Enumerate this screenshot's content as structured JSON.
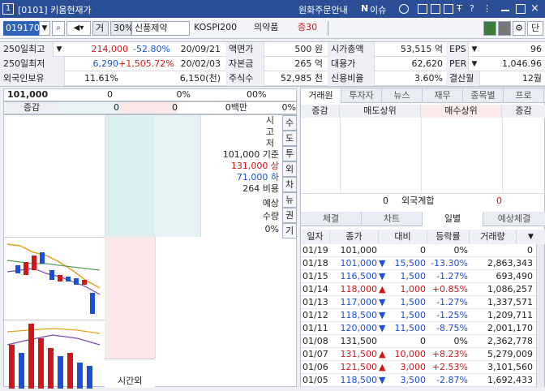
{
  "titlebar": {
    "num": "1",
    "title": "[0101] 키움현재가",
    "items": [
      "원화주문안내",
      "N",
      "이슈"
    ]
  },
  "toolbar": {
    "code": "019170",
    "type": "거",
    "ratio": "30%",
    "name": "신풍제약",
    "index": "KOSPI200",
    "sector": "의약품",
    "margin": "증30"
  },
  "info": [
    {
      "l1": "250일최고",
      "v1": "214,000",
      "v1c": "red",
      "p1": "-52.80%",
      "p1c": "blue",
      "d1": "20/09/21",
      "l2": "액면가",
      "v2": "500 원",
      "l3": "시가총액",
      "v3": "53,515 억",
      "l4": "EPS",
      "v4": "96"
    },
    {
      "l1": "250일최저",
      "v1": "6,290",
      "v1c": "blue",
      "p1": "+1,505.72%",
      "p1c": "red",
      "d1": "20/02/03",
      "l2": "자본금",
      "v2": "265 억",
      "l3": "대용가",
      "v3": "62,620",
      "l4": "PER",
      "v4": "1,046.96"
    },
    {
      "l1": "외국인보유",
      "v1": "11.61%",
      "v1c": "",
      "p1": "6,150(천)",
      "p1c": "",
      "d1": "",
      "l2": "주식수",
      "v2": "52,985 천",
      "l3": "신용비율",
      "v3": "3.60%",
      "l4": "결산월",
      "v4": "12월"
    }
  ],
  "orderbook": {
    "price": "101,000",
    "z1": "0",
    "z2": "0%",
    "z3": "0",
    "z4": "0%",
    "sub_label": "증감",
    "sub1": "0",
    "sub2": "0",
    "sub3": "0백만",
    "sub4": "0%",
    "mid_lines": [
      {
        "t": "시",
        "c": ""
      },
      {
        "t": "고",
        "c": ""
      },
      {
        "t": "저",
        "c": ""
      },
      {
        "t": "101,000 기준",
        "c": ""
      },
      {
        "t": "131,000 상",
        "c": "red"
      },
      {
        "t": "71,000 하",
        "c": "blue"
      },
      {
        "t": "264 비용",
        "c": ""
      },
      {
        "t": "예상",
        "c": ""
      },
      {
        "t": "수량",
        "c": ""
      },
      {
        "t": "0%",
        "c": ""
      }
    ],
    "vtabs": [
      "수",
      "도",
      "투",
      "외",
      "차",
      "뉴",
      "권",
      "기"
    ],
    "after_hours": "시간외"
  },
  "right": {
    "top_tabs": [
      "거래원",
      "투자자",
      "뉴스",
      "재무",
      "종목별",
      "프로"
    ],
    "broker_headers": [
      "증감",
      "매도상위",
      "매수상위",
      "증감"
    ],
    "foreign": {
      "left": "0",
      "label": "외국계합",
      "right": "0"
    },
    "bottom_tabs": [
      "체결",
      "차트",
      "일별",
      "예상체결"
    ],
    "daily_headers": [
      "일자",
      "종가",
      "대비",
      "등락률",
      "거래량"
    ],
    "daily": [
      {
        "date": "01/19",
        "close": "101,000",
        "dir": "",
        "chg": "0",
        "rate": "0%",
        "vol": "0",
        "c": ""
      },
      {
        "date": "01/18",
        "close": "101,000",
        "dir": "▼",
        "chg": "15,500",
        "rate": "-13.30%",
        "vol": "2,863,343",
        "c": "blue"
      },
      {
        "date": "01/15",
        "close": "116,500",
        "dir": "▼",
        "chg": "1,500",
        "rate": "-1.27%",
        "vol": "693,490",
        "c": "blue"
      },
      {
        "date": "01/14",
        "close": "118,000",
        "dir": "▲",
        "chg": "1,000",
        "rate": "+0.85%",
        "vol": "1,086,257",
        "c": "red"
      },
      {
        "date": "01/13",
        "close": "117,000",
        "dir": "▼",
        "chg": "1,500",
        "rate": "-1.27%",
        "vol": "1,337,571",
        "c": "blue"
      },
      {
        "date": "01/12",
        "close": "118,500",
        "dir": "▼",
        "chg": "1,500",
        "rate": "-1.25%",
        "vol": "1,209,711",
        "c": "blue"
      },
      {
        "date": "01/11",
        "close": "120,000",
        "dir": "▼",
        "chg": "11,500",
        "rate": "-8.75%",
        "vol": "2,001,170",
        "c": "blue"
      },
      {
        "date": "01/08",
        "close": "131,500",
        "dir": "",
        "chg": "0",
        "rate": "0%",
        "vol": "2,362,778",
        "c": ""
      },
      {
        "date": "01/07",
        "close": "131,500",
        "dir": "▲",
        "chg": "10,000",
        "rate": "+8.23%",
        "vol": "5,279,009",
        "c": "red"
      },
      {
        "date": "01/06",
        "close": "121,500",
        "dir": "▲",
        "chg": "3,000",
        "rate": "+2.53%",
        "vol": "3,101,560",
        "c": "red"
      },
      {
        "date": "01/05",
        "close": "118,500",
        "dir": "▼",
        "chg": "3,500",
        "rate": "-2.87%",
        "vol": "1,692,433",
        "c": "blue"
      }
    ]
  }
}
